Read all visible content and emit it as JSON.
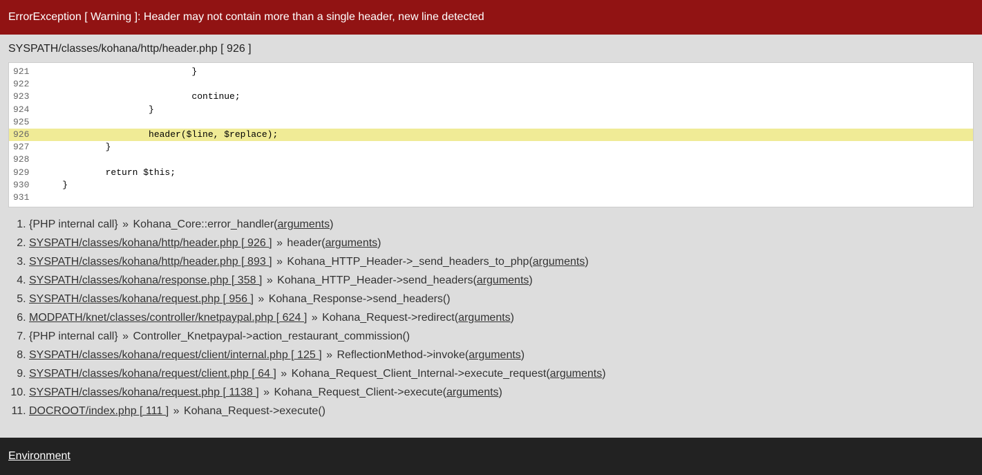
{
  "error_header": "ErrorException [ Warning ]: Header may not contain more than a single header, new line detected",
  "file_header": "SYSPATH/classes/kohana/http/header.php [ 926 ]",
  "code_lines": [
    {
      "num": "921",
      "text": "                            }",
      "hl": false
    },
    {
      "num": "922",
      "text": "",
      "hl": false
    },
    {
      "num": "923",
      "text": "                            continue;",
      "hl": false
    },
    {
      "num": "924",
      "text": "                    }",
      "hl": false
    },
    {
      "num": "925",
      "text": "",
      "hl": false
    },
    {
      "num": "926",
      "text": "                    header($line, $replace);",
      "hl": true
    },
    {
      "num": "927",
      "text": "            }",
      "hl": false
    },
    {
      "num": "928",
      "text": "",
      "hl": false
    },
    {
      "num": "929",
      "text": "            return $this;",
      "hl": false
    },
    {
      "num": "930",
      "text": "    }",
      "hl": false
    },
    {
      "num": "931",
      "text": "",
      "hl": false
    }
  ],
  "trace": [
    {
      "pre": "{PHP internal call}",
      "pre_link": false,
      "call": "Kohana_Core::error_handler(",
      "args": "arguments",
      "post": ")"
    },
    {
      "pre": "SYSPATH/classes/kohana/http/header.php [ 926 ]",
      "pre_link": true,
      "call": "header(",
      "args": "arguments",
      "post": ")"
    },
    {
      "pre": "SYSPATH/classes/kohana/http/header.php [ 893 ]",
      "pre_link": true,
      "call": "Kohana_HTTP_Header->_send_headers_to_php(",
      "args": "arguments",
      "post": ")"
    },
    {
      "pre": "SYSPATH/classes/kohana/response.php [ 358 ]",
      "pre_link": true,
      "call": "Kohana_HTTP_Header->send_headers(",
      "args": "arguments",
      "post": ")"
    },
    {
      "pre": "SYSPATH/classes/kohana/request.php [ 956 ]",
      "pre_link": true,
      "call": "Kohana_Response->send_headers()",
      "args": null,
      "post": ""
    },
    {
      "pre": "MODPATH/knet/classes/controller/knetpaypal.php [ 624 ]",
      "pre_link": true,
      "call": "Kohana_Request->redirect(",
      "args": "arguments",
      "post": ")"
    },
    {
      "pre": "{PHP internal call}",
      "pre_link": false,
      "call": "Controller_Knetpaypal->action_restaurant_commission()",
      "args": null,
      "post": ""
    },
    {
      "pre": "SYSPATH/classes/kohana/request/client/internal.php [ 125 ]",
      "pre_link": true,
      "call": "ReflectionMethod->invoke(",
      "args": "arguments",
      "post": ")"
    },
    {
      "pre": "SYSPATH/classes/kohana/request/client.php [ 64 ]",
      "pre_link": true,
      "call": "Kohana_Request_Client_Internal->execute_request(",
      "args": "arguments",
      "post": ")"
    },
    {
      "pre": "SYSPATH/classes/kohana/request.php [ 1138 ]",
      "pre_link": true,
      "call": "Kohana_Request_Client->execute(",
      "args": "arguments",
      "post": ")"
    },
    {
      "pre": "DOCROOT/index.php [ 111 ]",
      "pre_link": true,
      "call": "Kohana_Request->execute()",
      "args": null,
      "post": ""
    }
  ],
  "separator": "»",
  "environment_label": "Environment"
}
